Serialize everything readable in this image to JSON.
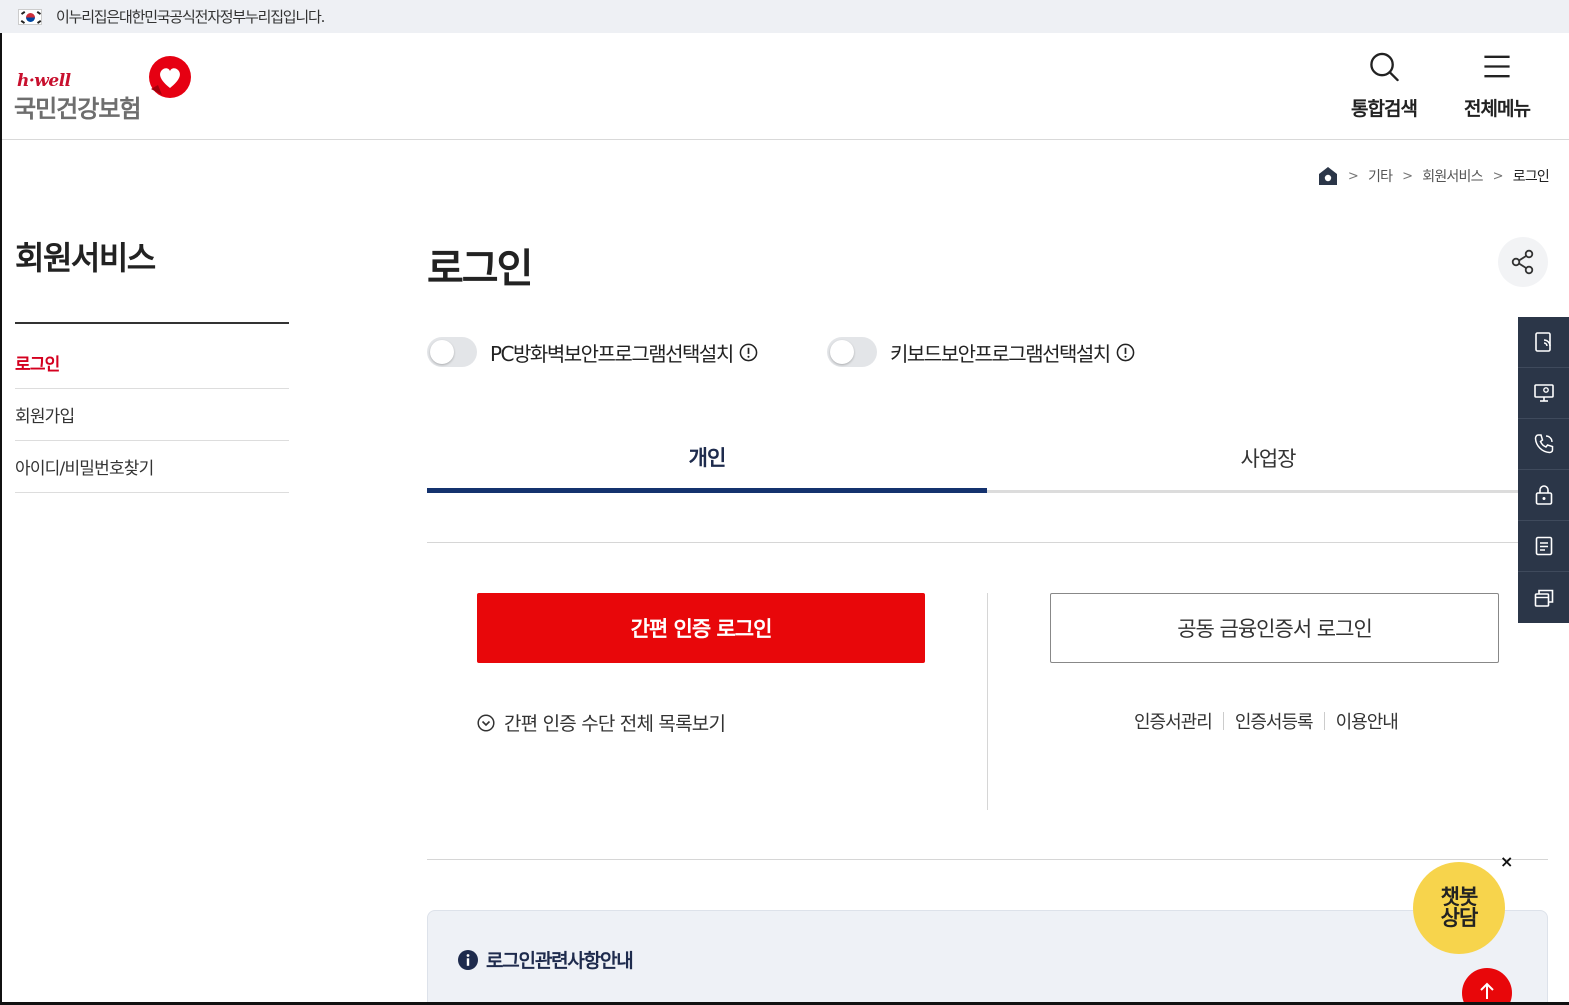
{
  "gov_banner": {
    "text": "이누리집은대한민국공식전자정부누리집입니다."
  },
  "logo": {
    "brand": "h·well",
    "name": "국민건강보험"
  },
  "header": {
    "search_label": "통합검색",
    "menu_label": "전체메뉴",
    "search_icon": "search-icon",
    "menu_icon": "hamburger-icon"
  },
  "breadcrumb": {
    "items": [
      "기타",
      "회원서비스",
      "로그인"
    ]
  },
  "sidebar": {
    "title": "회원서비스",
    "items": [
      {
        "label": "로그인",
        "active": true
      },
      {
        "label": "회원가입",
        "active": false
      },
      {
        "label": "아이디/비밀번호찾기",
        "active": false
      }
    ]
  },
  "main": {
    "title": "로그인",
    "toggles": [
      {
        "label": "PC방화벽보안프로그램선택설치",
        "on": false
      },
      {
        "label": "키보드보안프로그램선택설치",
        "on": false
      }
    ],
    "tabs": [
      {
        "label": "개인",
        "active": true
      },
      {
        "label": "사업장",
        "active": false
      }
    ],
    "simple_login_label": "간편 인증 로그인",
    "cert_login_label": "공동 금융인증서 로그인",
    "simple_list_label": "간편 인증 수단 전체 목록보기",
    "cert_links": [
      "인증서관리",
      "인증서등록",
      "이용안내"
    ],
    "notice_title": "로그인관련사항안내"
  },
  "chatbot": {
    "label_line1": "챗봇",
    "label_line2": "상담",
    "close": "×"
  },
  "colors": {
    "primary_red": "#e8070a",
    "navy": "#14326e",
    "quick_bar": "#2b3648",
    "chatbot_yellow": "#f7d44c"
  }
}
